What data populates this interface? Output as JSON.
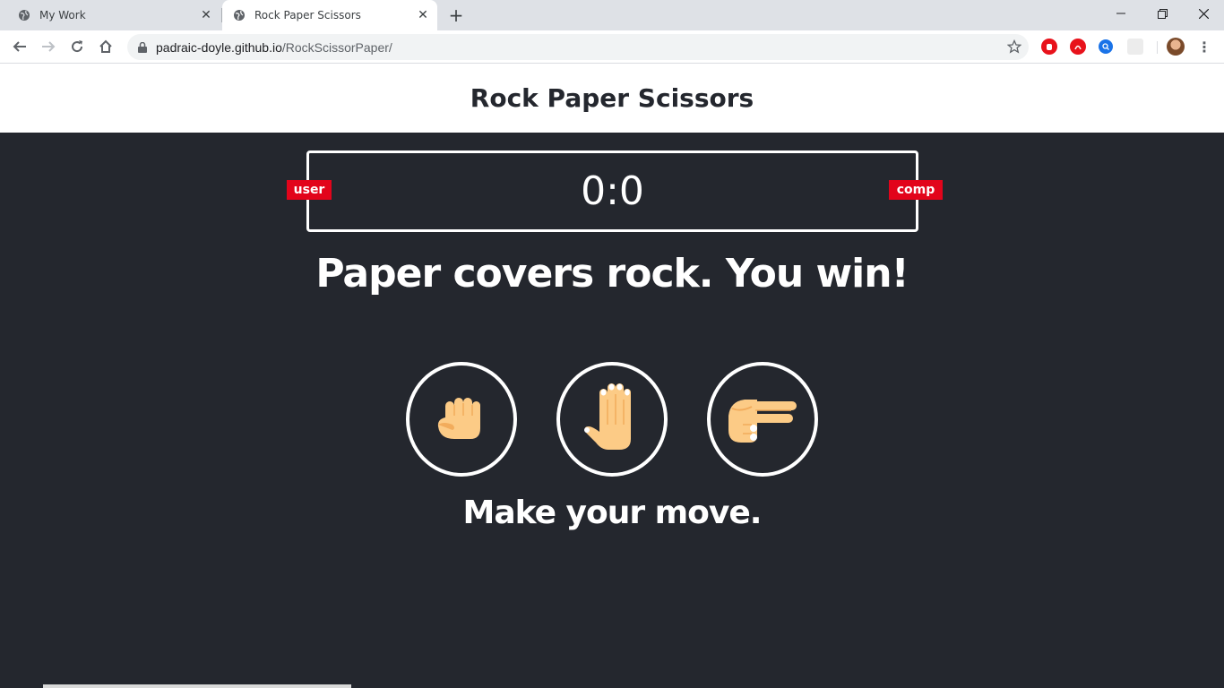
{
  "browser": {
    "tabs": [
      {
        "title": "My Work",
        "active": false
      },
      {
        "title": "Rock Paper Scissors",
        "active": true
      }
    ],
    "url_host": "padraic-doyle.github.io",
    "url_path": "/RockScissorPaper/",
    "extension_colors": [
      "#e8121b",
      "#e8121b",
      "#1a73e8",
      "#e0e0e0"
    ]
  },
  "page": {
    "title": "Rock Paper Scissors",
    "score": "0:0",
    "user_badge": "user",
    "comp_badge": "comp",
    "result_message": "Paper covers rock. You win!",
    "prompt": "Make your move.",
    "choices": [
      {
        "name": "rock",
        "icon": "rock-hand-icon"
      },
      {
        "name": "paper",
        "icon": "paper-hand-icon"
      },
      {
        "name": "scissors",
        "icon": "scissors-hand-icon"
      }
    ]
  },
  "colors": {
    "background": "#24272e",
    "badge": "#e2041b",
    "hand_skin": "#fccb86",
    "hand_shade": "#f2ac5c"
  }
}
